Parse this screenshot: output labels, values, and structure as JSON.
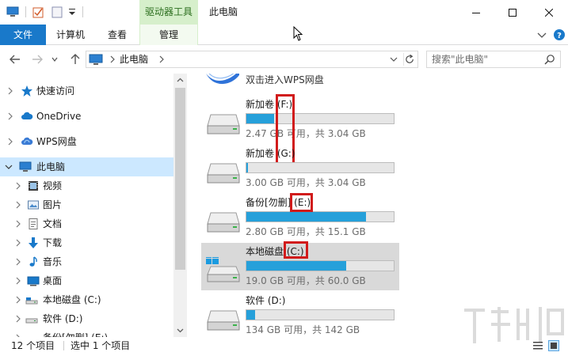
{
  "window": {
    "title": "此电脑",
    "context_tab": "驱动器工具"
  },
  "ribbon": {
    "tabs": [
      {
        "label": "文件"
      },
      {
        "label": "计算机"
      },
      {
        "label": "查看"
      },
      {
        "label": "管理"
      }
    ]
  },
  "address": {
    "path": "此电脑",
    "search_placeholder": "搜索\"此电脑\""
  },
  "navpane": {
    "items": [
      {
        "label": "快速访问",
        "icon": "star-icon"
      },
      {
        "label": "OneDrive",
        "icon": "cloud-icon"
      },
      {
        "label": "WPS网盘",
        "icon": "wps-cloud-icon"
      },
      {
        "label": "此电脑",
        "icon": "computer-icon"
      },
      {
        "label": "视频",
        "icon": "video-folder-icon"
      },
      {
        "label": "图片",
        "icon": "pictures-folder-icon"
      },
      {
        "label": "文档",
        "icon": "documents-folder-icon"
      },
      {
        "label": "下载",
        "icon": "downloads-folder-icon"
      },
      {
        "label": "音乐",
        "icon": "music-folder-icon"
      },
      {
        "label": "桌面",
        "icon": "desktop-folder-icon"
      },
      {
        "label": "本地磁盘 (C:)",
        "icon": "drive-icon"
      },
      {
        "label": "软件 (D:)",
        "icon": "drive-icon"
      },
      {
        "label": "备份[勿删] (E:)",
        "icon": "drive-icon"
      }
    ]
  },
  "content": {
    "wps_label": "双击进入WPS网盘",
    "drives": [
      {
        "name": "新加卷 (F:)",
        "used_fraction": 0.19,
        "info": "2.47 GB 可用，共 3.04 GB",
        "highlight": "(F:)"
      },
      {
        "name": "新加卷 (G:)",
        "used_fraction": 0.01,
        "info": "3.00 GB 可用，共 3.04 GB",
        "highlight": "(G:)"
      },
      {
        "name": "备份[勿删] (E:)",
        "used_fraction": 0.81,
        "info": "2.80 GB 可用，共 15.1 GB",
        "highlight": "(E:)"
      },
      {
        "name": "本地磁盘 (C:)",
        "used_fraction": 0.68,
        "info": "19.0 GB 可用，共 60.0 GB",
        "highlight": "(C:)"
      },
      {
        "name": "软件 (D:)",
        "used_fraction": 0.06,
        "info": "134 GB 可用，共 142 GB",
        "highlight": ""
      }
    ]
  },
  "status": {
    "item_count": "12 个项目",
    "selected": "选中 1 个项目"
  },
  "colors": {
    "accent": "#1979ca",
    "drive_bar": "#26a0da",
    "selection": "#cce8ff",
    "highlight_box": "#d11b1b"
  }
}
